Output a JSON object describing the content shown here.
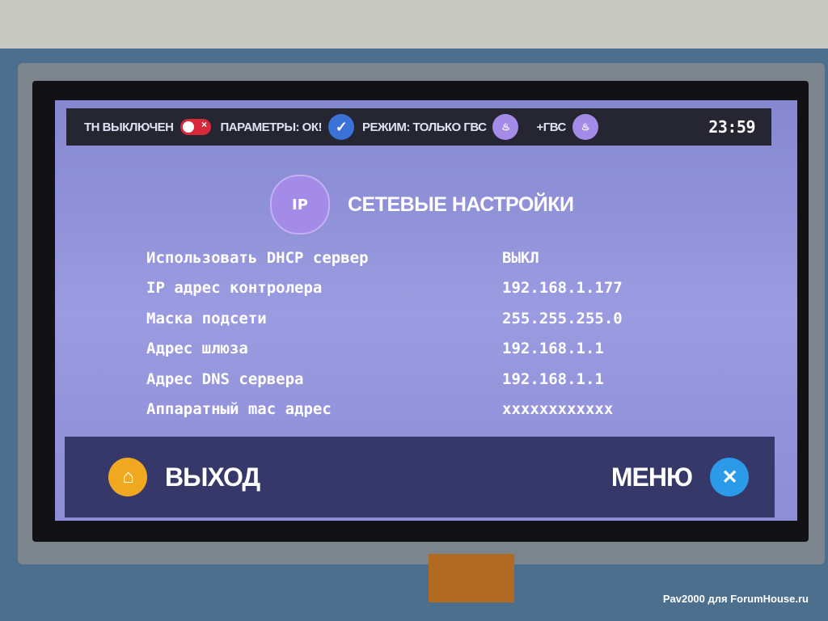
{
  "status_bar": {
    "heat_pump": "ТН ВЫКЛЮЧЕН",
    "params": "ПАРАМЕТРЫ: ОК!",
    "mode": "РЕЖИМ: ТОЛЬКО ГВС",
    "extra": "+ГВС",
    "time": "23:59"
  },
  "page": {
    "title": "СЕТЕВЫЕ НАСТРОЙКИ",
    "icon_text": "IP"
  },
  "settings": [
    {
      "label": "Использовать DHCP сервер",
      "value": "ВЫКЛ"
    },
    {
      "label": "IP адрес контролера",
      "value": "192.168.1.177"
    },
    {
      "label": "Маска подсети",
      "value": "255.255.255.0"
    },
    {
      "label": "Адрес шлюза",
      "value": "192.168.1.1"
    },
    {
      "label": "Адрес DNS сервера",
      "value": "192.168.1.1"
    },
    {
      "label": "Аппаратный mac адрес",
      "value": "xxxxxxxxxxxx"
    }
  ],
  "footer": {
    "exit_label": "ВЫХОД",
    "menu_label": "МЕНЮ"
  },
  "watermark": "Pav2000 для ForumHouse.ru",
  "colors": {
    "screen_bg": "#9a9be0",
    "topbar": "#262532",
    "bottombar": "#37386a",
    "toggle_off": "#d8283a",
    "check": "#3a72d8",
    "mode_icon": "#a58be8",
    "home_icon": "#f0a820",
    "tools_icon": "#2b9ae8"
  }
}
